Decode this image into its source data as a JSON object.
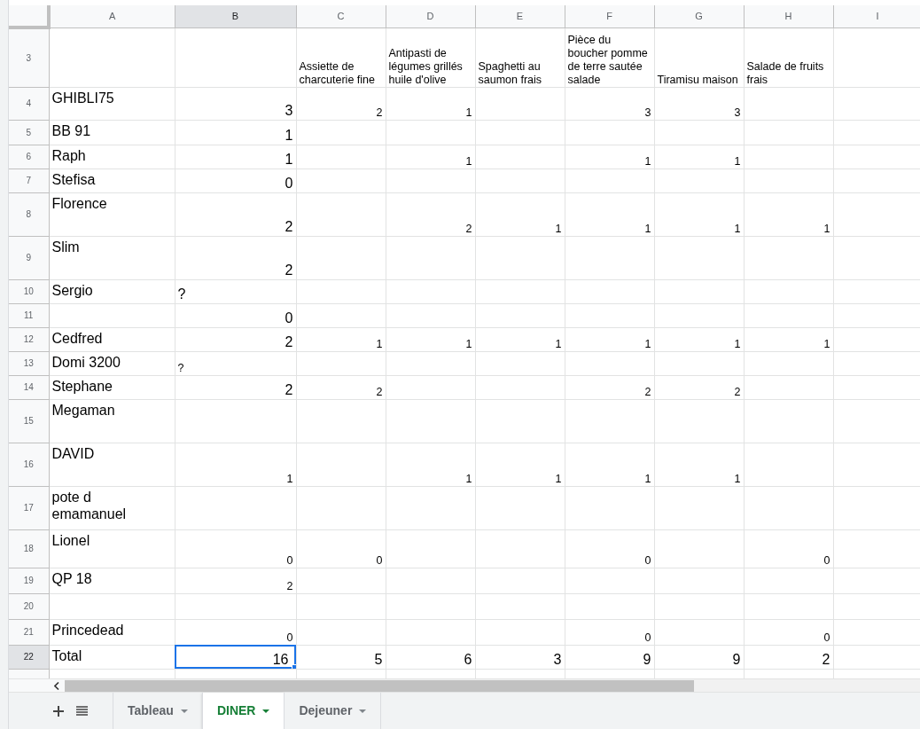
{
  "columns": [
    {
      "label": "A",
      "selected": false
    },
    {
      "label": "B",
      "selected": true
    },
    {
      "label": "C",
      "selected": false
    },
    {
      "label": "D",
      "selected": false
    },
    {
      "label": "E",
      "selected": false
    },
    {
      "label": "F",
      "selected": false
    },
    {
      "label": "G",
      "selected": false
    },
    {
      "label": "H",
      "selected": false
    },
    {
      "label": "I",
      "selected": false
    }
  ],
  "rows": [
    {
      "number": "3",
      "selected": false,
      "cells": {
        "C": {
          "text": "Assiette de charcuterie fine",
          "kind": "text"
        },
        "D": {
          "text": "Antipasti de légumes grillés huile d'olive",
          "kind": "text"
        },
        "E": {
          "text": "Spaghetti au saumon frais",
          "kind": "text"
        },
        "F": {
          "text": "Pièce du boucher pomme de terre sautée salade",
          "kind": "text"
        },
        "G": {
          "text": "Tiramisu maison",
          "kind": "text"
        },
        "H": {
          "text": "Salade de fruits frais",
          "kind": "text"
        }
      }
    },
    {
      "number": "4",
      "selected": false,
      "cells": {
        "A": {
          "text": "GHIBLI75",
          "kind": "text"
        },
        "B": {
          "text": "3",
          "kind": "number"
        },
        "C": {
          "text": "2",
          "kind": "number"
        },
        "D": {
          "text": "1",
          "kind": "number"
        },
        "F": {
          "text": "3",
          "kind": "number"
        },
        "G": {
          "text": "3",
          "kind": "number"
        }
      }
    },
    {
      "number": "5",
      "selected": false,
      "cells": {
        "A": {
          "text": "BB 91",
          "kind": "text"
        },
        "B": {
          "text": "1",
          "kind": "number"
        }
      }
    },
    {
      "number": "6",
      "selected": false,
      "cells": {
        "A": {
          "text": "Raph",
          "kind": "text"
        },
        "B": {
          "text": "1",
          "kind": "number"
        },
        "D": {
          "text": "1",
          "kind": "number"
        },
        "F": {
          "text": "1",
          "kind": "number"
        },
        "G": {
          "text": "1",
          "kind": "number"
        }
      }
    },
    {
      "number": "7",
      "selected": false,
      "cells": {
        "A": {
          "text": "Stefisa",
          "kind": "text"
        },
        "B": {
          "text": "0",
          "kind": "number"
        }
      }
    },
    {
      "number": "8",
      "selected": false,
      "cells": {
        "A": {
          "text": "Florence",
          "kind": "text"
        },
        "B": {
          "text": "2",
          "kind": "number"
        },
        "D": {
          "text": "2",
          "kind": "number"
        },
        "E": {
          "text": "1",
          "kind": "number"
        },
        "F": {
          "text": "1",
          "kind": "number"
        },
        "G": {
          "text": "1",
          "kind": "number"
        },
        "H": {
          "text": "1",
          "kind": "number"
        }
      }
    },
    {
      "number": "9",
      "selected": false,
      "cells": {
        "A": {
          "text": "Slim",
          "kind": "text"
        },
        "B": {
          "text": "2",
          "kind": "number"
        }
      }
    },
    {
      "number": "10",
      "selected": false,
      "cells": {
        "A": {
          "text": "Sergio",
          "kind": "text"
        },
        "B": {
          "text": "?",
          "kind": "text"
        }
      }
    },
    {
      "number": "11",
      "selected": false,
      "cells": {
        "B": {
          "text": "0",
          "kind": "number"
        }
      }
    },
    {
      "number": "12",
      "selected": false,
      "cells": {
        "A": {
          "text": "Cedfred",
          "kind": "text"
        },
        "B": {
          "text": "2",
          "kind": "number"
        },
        "C": {
          "text": "1",
          "kind": "number"
        },
        "D": {
          "text": "1",
          "kind": "number"
        },
        "E": {
          "text": "1",
          "kind": "number"
        },
        "F": {
          "text": "1",
          "kind": "number"
        },
        "G": {
          "text": "1",
          "kind": "number"
        },
        "H": {
          "text": "1",
          "kind": "number"
        }
      }
    },
    {
      "number": "13",
      "selected": false,
      "cells": {
        "A": {
          "text": "Domi 3200",
          "kind": "text"
        },
        "B": {
          "text": "?",
          "kind": "text"
        }
      }
    },
    {
      "number": "14",
      "selected": false,
      "cells": {
        "A": {
          "text": "Stephane",
          "kind": "text"
        },
        "B": {
          "text": "2",
          "kind": "number"
        },
        "C": {
          "text": "2",
          "kind": "number"
        },
        "F": {
          "text": "2",
          "kind": "number"
        },
        "G": {
          "text": "2",
          "kind": "number"
        }
      }
    },
    {
      "number": "15",
      "selected": false,
      "cells": {
        "A": {
          "text": "Megaman",
          "kind": "text"
        }
      }
    },
    {
      "number": "16",
      "selected": false,
      "cells": {
        "A": {
          "text": "DAVID",
          "kind": "text"
        },
        "B": {
          "text": "1",
          "kind": "number"
        },
        "D": {
          "text": "1",
          "kind": "number"
        },
        "E": {
          "text": "1",
          "kind": "number"
        },
        "F": {
          "text": "1",
          "kind": "number"
        },
        "G": {
          "text": "1",
          "kind": "number"
        }
      }
    },
    {
      "number": "17",
      "selected": false,
      "cells": {
        "A": {
          "text": "pote d\nemamanuel",
          "kind": "text"
        }
      }
    },
    {
      "number": "18",
      "selected": false,
      "cells": {
        "A": {
          "text": "Lionel",
          "kind": "text"
        },
        "B": {
          "text": "0",
          "kind": "number"
        },
        "C": {
          "text": "0",
          "kind": "number"
        },
        "F": {
          "text": "0",
          "kind": "number"
        },
        "H": {
          "text": "0",
          "kind": "number"
        }
      }
    },
    {
      "number": "19",
      "selected": false,
      "cells": {
        "A": {
          "text": "QP 18",
          "kind": "text"
        },
        "B": {
          "text": "2",
          "kind": "number"
        }
      }
    },
    {
      "number": "20",
      "selected": false
    },
    {
      "number": "21",
      "selected": false,
      "cells": {
        "A": {
          "text": "Princedead",
          "kind": "text"
        },
        "B": {
          "text": "0",
          "kind": "number"
        },
        "F": {
          "text": "0",
          "kind": "number"
        },
        "H": {
          "text": "0",
          "kind": "number"
        }
      }
    },
    {
      "number": "22",
      "selected": true,
      "cells": {
        "A": {
          "text": "Total",
          "kind": "text"
        },
        "B": {
          "text": "16",
          "kind": "number"
        },
        "C": {
          "text": "5",
          "kind": "number"
        },
        "D": {
          "text": "6",
          "kind": "number"
        },
        "E": {
          "text": "3",
          "kind": "number"
        },
        "F": {
          "text": "9",
          "kind": "number"
        },
        "G": {
          "text": "9",
          "kind": "number"
        },
        "H": {
          "text": "2",
          "kind": "number"
        }
      }
    }
  ],
  "sheet_tabs": [
    {
      "label": "Tableau",
      "selected": false
    },
    {
      "label": "DINER",
      "selected": true
    },
    {
      "label": "Dejeuner",
      "selected": false
    }
  ]
}
